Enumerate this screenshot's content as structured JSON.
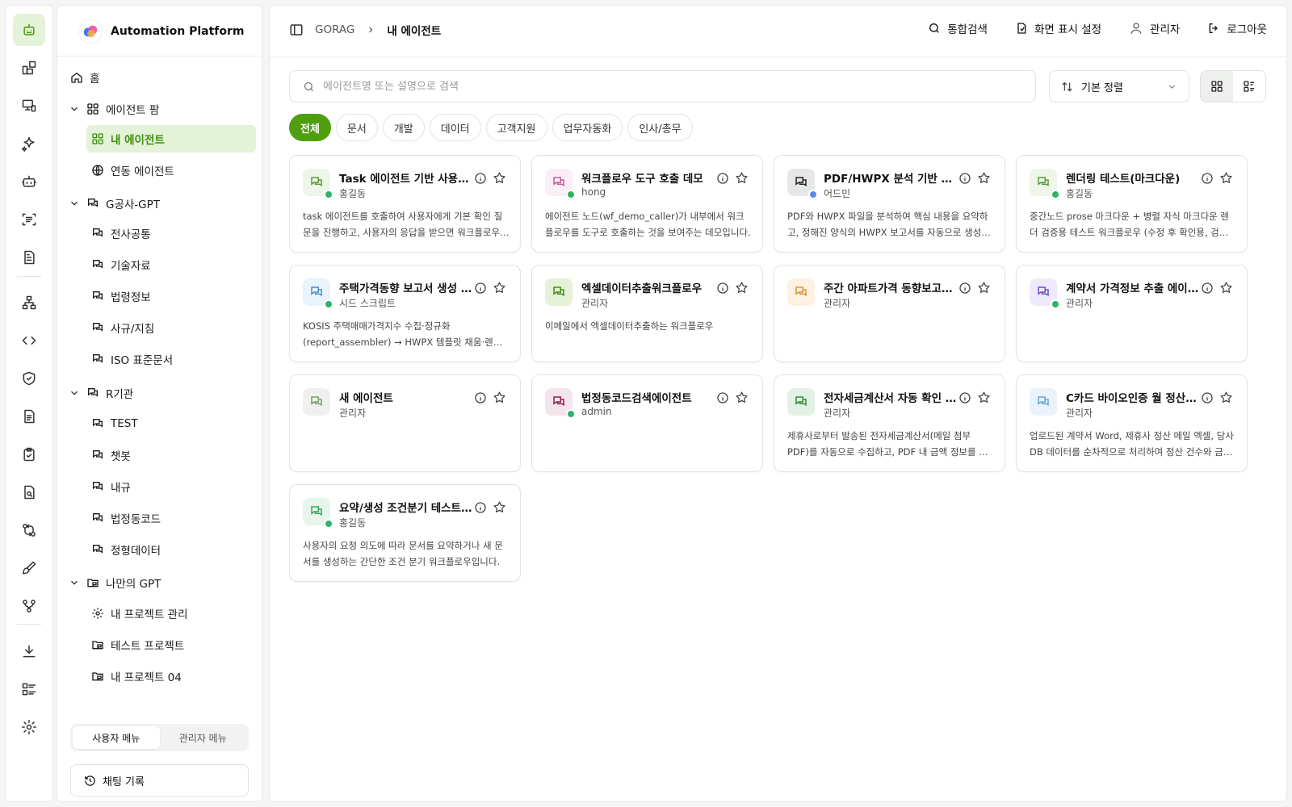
{
  "app": {
    "title": "Automation Platform"
  },
  "rail_icons": [
    "robot-icon",
    "widgets-icon",
    "monitor-icon",
    "sparkles-icon",
    "bot-icon",
    "scan-text-icon",
    "document-icon",
    "hierarchy-icon",
    "code-icon",
    "shield-check-icon",
    "file-text-icon",
    "clipboard-check-icon",
    "file-search-icon",
    "git-compare-icon",
    "brush-icon",
    "workflow-icon",
    "download-icon",
    "list-icon",
    "gear-icon"
  ],
  "sidebar": {
    "home": "홈",
    "agent_farm": {
      "label": "에이전트 팜",
      "items": [
        "내 에이전트",
        "연동 에이전트"
      ]
    },
    "g_gpt": {
      "label": "G공사-GPT",
      "items": [
        "전사공통",
        "기술자료",
        "법령정보",
        "사규/지침",
        "ISO 표준문서"
      ]
    },
    "r_org": {
      "label": "R기관",
      "items": [
        "TEST",
        "챗봇",
        "내규",
        "법정동코드",
        "정형데이터"
      ]
    },
    "my_gpt": {
      "label": "나만의 GPT",
      "items": [
        "내 프로젝트 관리",
        "테스트 프로젝트",
        "내 프로젝트 04"
      ]
    },
    "segment": {
      "user": "사용자 메뉴",
      "admin": "관리자 메뉴"
    },
    "history": "채팅 기록"
  },
  "header": {
    "breadcrumb": {
      "root": "GORAG",
      "current": "내 에이전트"
    },
    "actions": {
      "search": "통합검색",
      "display": "화면 표시 설정",
      "user": "관리자",
      "logout": "로그아웃"
    }
  },
  "toolbar": {
    "search_placeholder": "에이전트명 또는 설명으로 검색",
    "sort_label": "기본 정렬"
  },
  "filters": [
    "전체",
    "문서",
    "개발",
    "데이터",
    "고객지원",
    "업무자동화",
    "인사/총무"
  ],
  "colors": {
    "accent": "#4f9e10",
    "accent_soft": "#e4f2d8"
  },
  "cards": [
    {
      "title": "Task 에이전트 기반 사용자 확인 워크플로우",
      "owner": "홍길동",
      "desc": "task 에이전트를 호출하여 사용자에게 기본 확인 질문을 진행하고, 사용자의 응답을 받으면 워크플로우가 계속 진행됩니다.",
      "bg": "#eef6ea",
      "fg": "#5c9a3c",
      "badge": "globe"
    },
    {
      "title": "워크플로우 도구 호출 데모",
      "owner": "hong",
      "desc": "에이전트 노드(wf_demo_caller)가 내부에서 워크플로우를 도구로 호출하는 것을 보여주는 데모입니다.",
      "bg": "#fbeef6",
      "fg": "#c45a9a",
      "badge": "globe"
    },
    {
      "title": "PDF/HWPX 분석 기반 한글 보고서 생성",
      "owner": "어드민",
      "desc": "PDF와 HWPX 파일을 분석하여 핵심 내용을 요약하고, 정해진 양식의 HWPX 보고서를 자동으로 생성합니다.",
      "bg": "#e6e8e6",
      "fg": "#222222",
      "badge": "lock"
    },
    {
      "title": "렌더링 테스트(마크다운)",
      "owner": "홍길동",
      "desc": "중간노드 prose 마크다운 + 병렬 자식 마크다운 렌더 검증용 테스트 워크플로우 (수정 후 확인용, 검증 끝나면 삭제)",
      "bg": "#eef6ea",
      "fg": "#5c9a3c",
      "badge": "globe"
    },
    {
      "title": "주택가격동향 보고서 생성 워크플로우",
      "owner": "시드 스크립트",
      "desc": "KOSIS 주택매매가격지수 수집·정규화(report_assembler) → HWPX 템플릿 채움·렌더링 파이프라인",
      "bg": "#e8f3fb",
      "fg": "#4a8fc4",
      "badge": "globe"
    },
    {
      "title": "엑셀데이터추출워크플로우",
      "owner": "관리자",
      "desc": "이메일에서 엑셀데이터추출하는 워크플로우",
      "bg": "#e4f2d8",
      "fg": "#3f8f0c",
      "badge": ""
    },
    {
      "title": "주간 아파트가격 동향보고서 생성",
      "owner": "관리자",
      "desc": "",
      "bg": "#fdf1e2",
      "fg": "#d9952f",
      "badge": ""
    },
    {
      "title": "계약서 가격정보 추출 에이전트",
      "owner": "관리자",
      "desc": "",
      "bg": "#efeafb",
      "fg": "#6b4fc4",
      "badge": "globe"
    },
    {
      "title": "새 에이전트",
      "owner": "관리자",
      "desc": "",
      "bg": "#eff1ef",
      "fg": "#7c9a6c",
      "badge": ""
    },
    {
      "title": "법정동코드검색에이전트",
      "owner": "admin",
      "desc": "",
      "bg": "#f6e4ec",
      "fg": "#8a1f4f",
      "badge": "globe"
    },
    {
      "title": "전자세금계산서 자동 확인 에이전트",
      "owner": "관리자",
      "desc": "제휴사로부터 발송된 전자세금계산서(메일 첨부 PDF)를 자동으로 수집하고, PDF 내 금액 정보를 추출한 후 검증합니다.",
      "bg": "#e4f2e6",
      "fg": "#2f8a3c",
      "badge": ""
    },
    {
      "title": "C카드 바이오인증 월 정산 에이전트",
      "owner": "관리자",
      "desc": "업로드된 계약서 Word, 제휴사 정산 메일 엑셀, 당사 DB 데이터를 순차적으로 처리하여 정산 건수와 금액을 검증합니다.",
      "bg": "#eaf3fb",
      "fg": "#6aa3d6",
      "badge": ""
    },
    {
      "title": "요약/생성 조건분기 테스트 워크플로우",
      "owner": "홍길동",
      "desc": "사용자의 요청 의도에 따라 문서를 요약하거나 새 문서를 생성하는 간단한 조건 분기 워크플로우입니다.",
      "bg": "#e6f6ea",
      "fg": "#3da35c",
      "badge": "globe"
    }
  ]
}
